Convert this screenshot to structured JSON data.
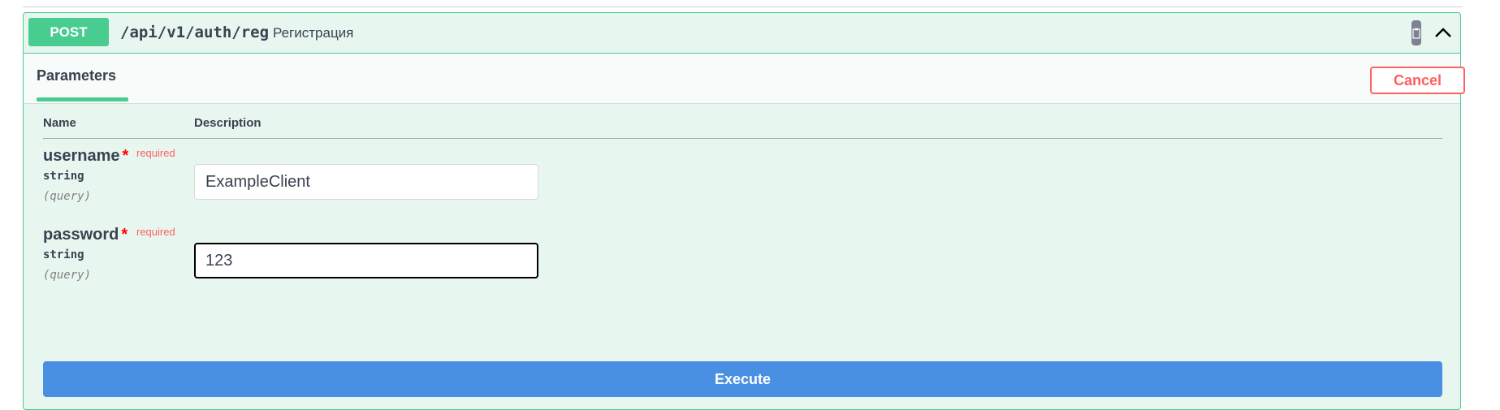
{
  "endpoint": {
    "method": "POST",
    "path": "/api/v1/auth/reg",
    "summary": "Регистрация",
    "colors": {
      "method_bg": "#49cc90",
      "block_bg": "#e8f6f0",
      "border": "#49cc90"
    }
  },
  "tabs": {
    "active": "Parameters",
    "cancel_label": "Cancel"
  },
  "table": {
    "col_name": "Name",
    "col_description": "Description"
  },
  "params": [
    {
      "name": "username",
      "star": "*",
      "required": "required",
      "type": "string",
      "in": "(query)",
      "value": "ExampleClient"
    },
    {
      "name": "password",
      "star": "*",
      "required": "required",
      "type": "string",
      "in": "(query)",
      "value": "123"
    }
  ],
  "actions": {
    "execute_label": "Execute",
    "execute_color": "#4990e2"
  },
  "icons": {
    "copy": "clipboard-icon",
    "collapse": "chevron-up-icon"
  }
}
